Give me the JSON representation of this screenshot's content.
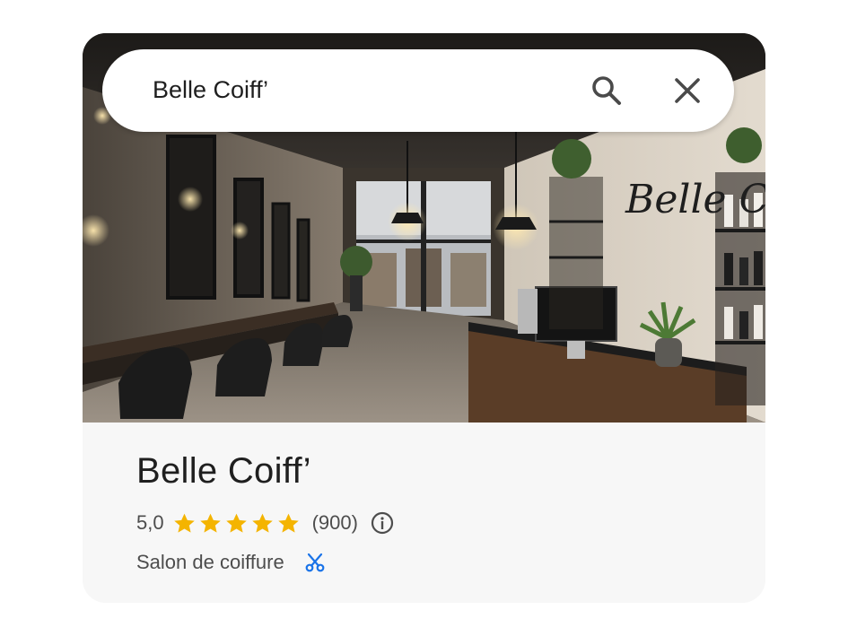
{
  "search": {
    "query": "Belle Coiff’"
  },
  "icons": {
    "search": "search-icon",
    "close": "close-icon",
    "star": "star-icon",
    "info": "info-icon",
    "category": "scissors-icon"
  },
  "place": {
    "name": "Belle Coiff’",
    "rating": "5,0",
    "stars": 5,
    "review_count": "(900)",
    "category": "Salon de coiffure"
  },
  "photo": {
    "wall_sign": "Belle Coiff’"
  },
  "colors": {
    "star": "#f4b400",
    "accent_blue": "#1a73e8",
    "text_primary": "#1f1f1f",
    "text_secondary": "#4d4d4d"
  }
}
